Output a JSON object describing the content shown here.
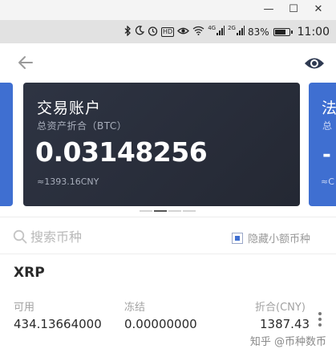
{
  "window": {
    "minimize": "—",
    "maximize": "☐",
    "close": "✕"
  },
  "status_bar": {
    "icons": [
      "bluetooth-icon",
      "moon-icon",
      "alarm-icon",
      "hd-icon",
      "eye-icon",
      "wifi-icon",
      "signal-icon",
      "signal-icon"
    ],
    "hd": "HD",
    "net_4g": "4G",
    "net_2g": "2G",
    "battery_percent": "83%",
    "battery_level": 0.83,
    "time": "11:00"
  },
  "header": {
    "back_icon": "arrow-left-icon",
    "eye_icon": "eye-icon"
  },
  "card": {
    "title": "交易账户",
    "subtitle": "总资产折合（BTC）",
    "balance": "0.03148256",
    "cny": "≈1393.16CNY",
    "background": "#2b303c"
  },
  "next_card": {
    "title": "法",
    "subtitle": "总",
    "balance": "-",
    "small": "≈C",
    "background": "#3f6fd1"
  },
  "search": {
    "placeholder": "搜索币种",
    "hide_small_label": "隐藏小额币种"
  },
  "coin": {
    "name": "XRP",
    "labels": {
      "available": "可用",
      "frozen": "冻结",
      "equivalent": "折合(CNY)"
    },
    "values": {
      "available": "434.13664000",
      "frozen": "0.00000000",
      "equivalent": "1387.43"
    }
  },
  "watermark": "知乎 @币种数币"
}
